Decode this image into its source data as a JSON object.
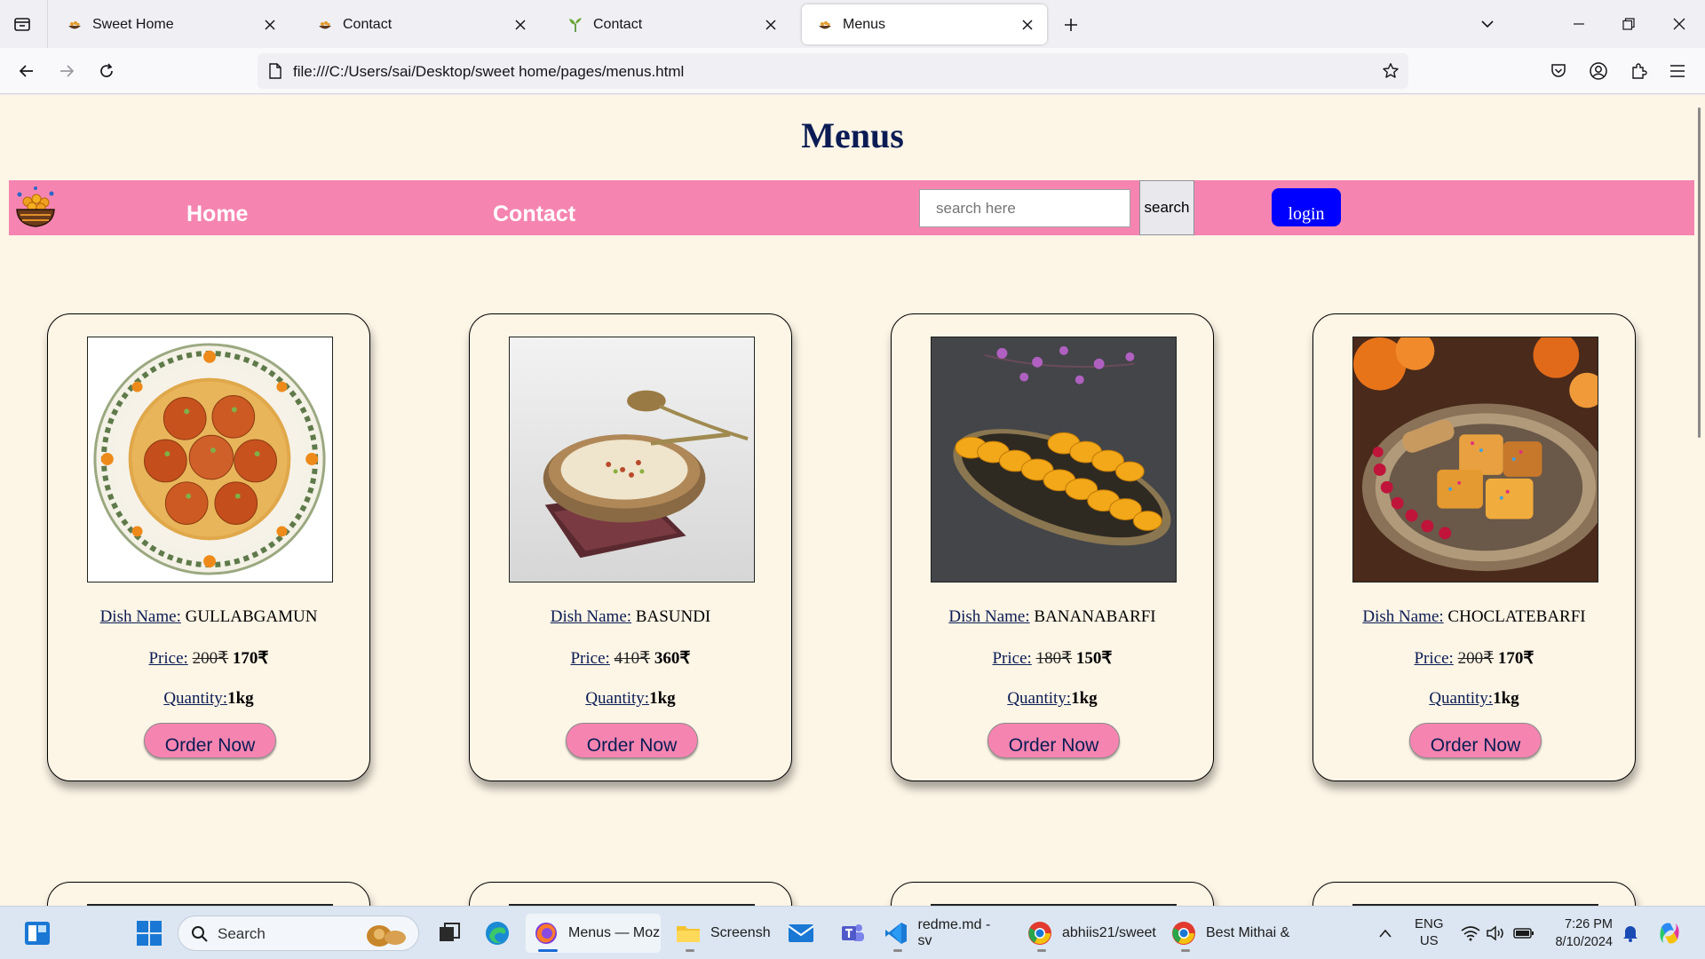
{
  "browser": {
    "tabs": [
      {
        "title": "Sweet Home",
        "active": false
      },
      {
        "title": "Contact",
        "active": false
      },
      {
        "title": "Contact",
        "active": false
      },
      {
        "title": "Menus",
        "active": true
      }
    ],
    "url": "file:///C:/Users/sai/Desktop/sweet home/pages/menus.html"
  },
  "page": {
    "title": "Menus",
    "nav": {
      "home": "Home",
      "contact": "Contact",
      "search_placeholder": "search here",
      "search_button": "search",
      "login_button": "login"
    },
    "labels": {
      "dish_name": "Dish Name:",
      "price": "Price:",
      "quantity": "Quantity:",
      "order_button": "Order Now"
    },
    "items": [
      {
        "name": "GULLABGAMUN",
        "old_price": "200₹",
        "new_price": "170₹",
        "quantity": "1kg"
      },
      {
        "name": "BASUNDI",
        "old_price": "410₹",
        "new_price": "360₹",
        "quantity": "1kg"
      },
      {
        "name": "BANANABARFI",
        "old_price": "180₹",
        "new_price": "150₹",
        "quantity": "1kg"
      },
      {
        "name": "CHOCLATEBARFI",
        "old_price": "200₹",
        "new_price": "170₹",
        "quantity": "1kg"
      }
    ]
  },
  "taskbar": {
    "search_label": "Search",
    "apps": [
      {
        "label": "Menus — Moz"
      },
      {
        "label": "Screensh"
      },
      {
        "label": "redme.md - sv"
      },
      {
        "label": "abhiis21/sweet"
      },
      {
        "label": "Best Mithai &"
      }
    ],
    "lang_line1": "ENG",
    "lang_line2": "US",
    "time": "7:26 PM",
    "date": "8/10/2024"
  },
  "colors": {
    "page_bg": "#fdf5e6",
    "nav_bg": "#f585b0",
    "title_color": "#0b1c55",
    "login_bg": "#0000ff"
  }
}
